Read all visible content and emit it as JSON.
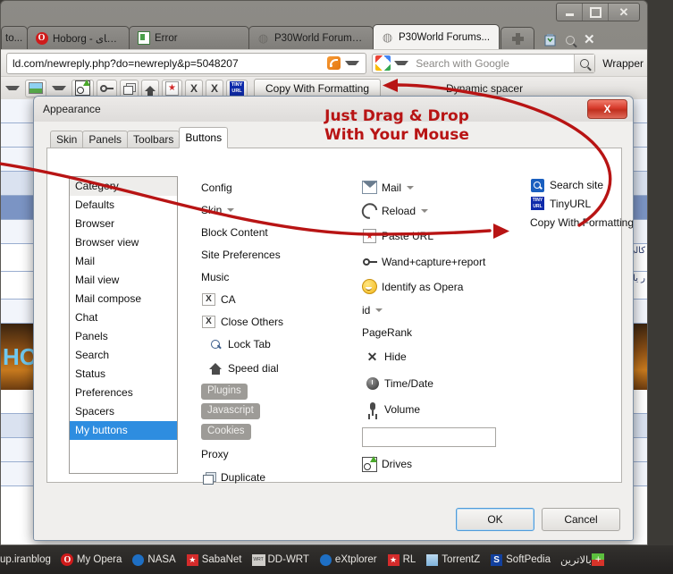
{
  "window": {
    "caption_buttons": [
      {
        "name": "minimize",
        "glyph": "minimize-icon"
      },
      {
        "name": "maximize",
        "glyph": "maximize-icon"
      },
      {
        "name": "close",
        "glyph": "✕"
      }
    ]
  },
  "tabs": [
    {
      "label": "to...",
      "icon": "page-icon",
      "active": false,
      "width": "tab-w0"
    },
    {
      "label": "Hoborg - مدیاهای ...",
      "icon": "opera-icon",
      "active": false,
      "width": "tab-w1"
    },
    {
      "label": "Error",
      "icon": "document-icon",
      "active": false,
      "width": "tab-w2"
    },
    {
      "label": "P30World Forums...",
      "icon": "ring-icon",
      "active": false,
      "width": "tab-w3"
    },
    {
      "label": "P30World Forums...",
      "icon": "ring-icon",
      "active": true,
      "width": "tab-w4"
    }
  ],
  "tab_tools": [
    {
      "name": "trash-icon",
      "glyph": "🗑"
    },
    {
      "name": "search-icon",
      "glyph": "search"
    },
    {
      "name": "close-icon",
      "glyph": "✕"
    }
  ],
  "address_bar": {
    "url": "ld.com/newreply.php?do=newreply&p=5048207",
    "rss_icon": "rss-icon",
    "dropdown_icon": "chevron-down-icon"
  },
  "search_bar": {
    "engine_icon": "google-icon",
    "placeholder": "Search with Google",
    "go_icon": "magnifier-icon"
  },
  "wrapper_label": "Wrapper",
  "toolbar": {
    "buttons": [
      {
        "name": "back-dropdown",
        "type": "caret"
      },
      {
        "name": "image-toggle",
        "type": "image"
      },
      {
        "name": "image-dropdown",
        "type": "caret"
      },
      {
        "name": "drives-button",
        "type": "drives"
      },
      {
        "name": "wand-button",
        "type": "key"
      },
      {
        "name": "duplicate-button",
        "type": "copy"
      },
      {
        "name": "home-button",
        "type": "home"
      },
      {
        "name": "paste-url-button",
        "type": "redstar"
      },
      {
        "name": "ca-button",
        "type": "x",
        "label": "X"
      },
      {
        "name": "close-others-button",
        "type": "x",
        "label": "X"
      },
      {
        "name": "tinyurl-button",
        "type": "tiny",
        "label": "TINY URL"
      }
    ],
    "copy_with_formatting": "Copy With Formatting",
    "dynamic_spacer": "Dynamic spacer"
  },
  "page_behind": {
    "rtl_line_1": "کالی مه",
    "rtl_line_2": "ر یا محتو",
    "banner_text": "HO"
  },
  "dialog": {
    "title": "Appearance",
    "close_label": "X",
    "tabs": [
      {
        "label": "Skin",
        "active": false
      },
      {
        "label": "Panels",
        "active": false
      },
      {
        "label": "Toolbars",
        "active": false
      },
      {
        "label": "Buttons",
        "active": true
      }
    ],
    "annotation": {
      "line1": "Just Drag & Drop",
      "line2": "With Your Mouse",
      "color": "#b81414"
    },
    "categories": [
      {
        "label": "Category",
        "state": "header"
      },
      {
        "label": "Defaults",
        "state": "normal"
      },
      {
        "label": "Browser",
        "state": "normal"
      },
      {
        "label": "Browser view",
        "state": "normal"
      },
      {
        "label": "Mail",
        "state": "normal"
      },
      {
        "label": "Mail view",
        "state": "normal"
      },
      {
        "label": "Mail compose",
        "state": "normal"
      },
      {
        "label": "Chat",
        "state": "normal"
      },
      {
        "label": "Panels",
        "state": "normal"
      },
      {
        "label": "Search",
        "state": "normal"
      },
      {
        "label": "Status",
        "state": "normal"
      },
      {
        "label": "Preferences",
        "state": "normal"
      },
      {
        "label": "Spacers",
        "state": "normal"
      },
      {
        "label": "My buttons",
        "state": "selected"
      }
    ],
    "column1": [
      {
        "label": "Config",
        "icon": "none",
        "dropdown": false
      },
      {
        "label": "Skin",
        "icon": "none",
        "dropdown": true
      },
      {
        "label": "Block Content",
        "icon": "none",
        "dropdown": false
      },
      {
        "label": "Site Preferences",
        "icon": "none",
        "dropdown": false
      },
      {
        "label": "Music",
        "icon": "none",
        "dropdown": false
      },
      {
        "label": "CA",
        "icon": "boxed-x-icon",
        "dropdown": false
      },
      {
        "label": "Close Others",
        "icon": "boxed-x-icon",
        "dropdown": false
      },
      {
        "label": "Lock Tab",
        "icon": "lock-icon",
        "dropdown": false
      },
      {
        "label": "Speed dial",
        "icon": "house-icon",
        "dropdown": false
      },
      {
        "label": "Plugins",
        "icon": "pill",
        "dropdown": false
      },
      {
        "label": "Javascript",
        "icon": "pill",
        "dropdown": false
      },
      {
        "label": "Cookies",
        "icon": "pill",
        "dropdown": false
      },
      {
        "label": "Proxy",
        "icon": "none",
        "dropdown": false
      },
      {
        "label": "Duplicate",
        "icon": "duplicate-icon",
        "dropdown": false
      }
    ],
    "column2": [
      {
        "label": "Mail",
        "icon": "mail-icon",
        "dropdown": true
      },
      {
        "label": "Reload",
        "icon": "reload-icon",
        "dropdown": true
      },
      {
        "label": "Paste URL",
        "icon": "paste-url-icon",
        "dropdown": false
      },
      {
        "label": "Wand+capture+report",
        "icon": "wand-icon",
        "dropdown": false
      },
      {
        "label": "Identify as Opera",
        "icon": "smiley-icon",
        "dropdown": false
      },
      {
        "label": "id",
        "icon": "none",
        "dropdown": true
      },
      {
        "label": "PageRank",
        "icon": "none",
        "dropdown": false
      },
      {
        "label": "Hide",
        "icon": "x-icon",
        "dropdown": false
      },
      {
        "label": "Time/Date",
        "icon": "clock-icon",
        "dropdown": false
      },
      {
        "label": "Volume",
        "icon": "microphone-icon",
        "dropdown": false
      },
      {
        "label": "",
        "icon": "empty-field",
        "dropdown": false
      },
      {
        "label": "Drives",
        "icon": "drives-icon",
        "dropdown": false
      }
    ],
    "column3": [
      {
        "label": "Search site",
        "icon": "search-site-icon",
        "dropdown": false
      },
      {
        "label": "TinyURL",
        "icon": "tinyurl-icon",
        "dropdown": false
      },
      {
        "label": "Copy With Formatting",
        "icon": "none",
        "dropdown": false
      }
    ],
    "footer": {
      "ok": "OK",
      "cancel": "Cancel"
    }
  },
  "taskbar": [
    {
      "label": "up.iranblog",
      "icon": "none"
    },
    {
      "label": "My Opera",
      "icon": "opera-icon"
    },
    {
      "label": "NASA",
      "icon": "nasa-icon"
    },
    {
      "label": "SabaNet",
      "icon": "red-star-icon"
    },
    {
      "label": "DD-WRT",
      "icon": "ddwrt-icon"
    },
    {
      "label": "eXtplorer",
      "icon": "extplorer-icon"
    },
    {
      "label": "RL",
      "icon": "red-star-icon"
    },
    {
      "label": "TorrentZ",
      "icon": "torrent-icon"
    },
    {
      "label": "SoftPedia",
      "icon": "softpedia-icon"
    },
    {
      "label": "بالاترین",
      "icon": "balatarin-icon"
    }
  ]
}
